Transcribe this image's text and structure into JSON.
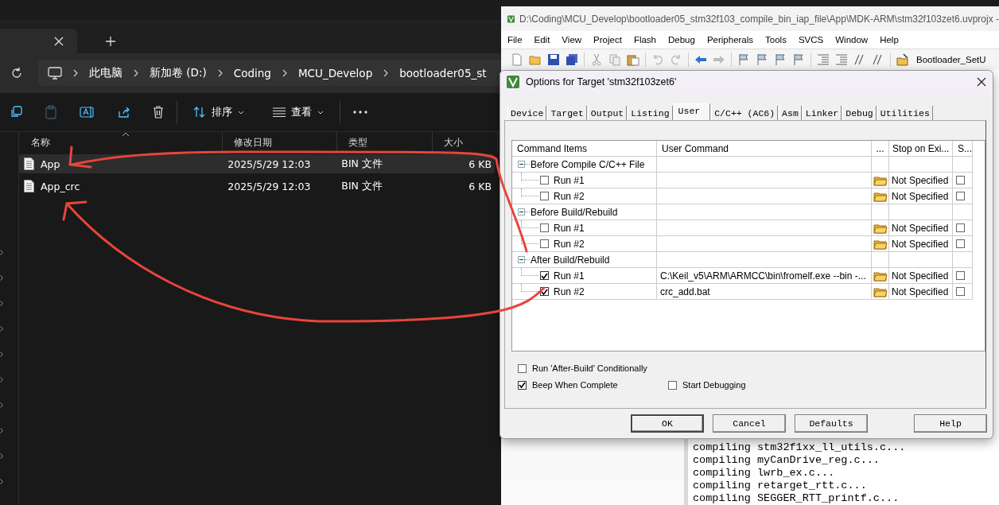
{
  "explorer": {
    "breadcrumb": [
      "此电脑",
      "新加卷 (D:)",
      "Coding",
      "MCU_Develop",
      "bootloader05_st"
    ],
    "toolbar": {
      "sort": "排序",
      "view": "查看"
    },
    "columns": [
      "名称",
      "修改日期",
      "类型",
      "大小"
    ],
    "files": [
      {
        "name": "App",
        "date": "2025/5/29 12:03",
        "type": "BIN 文件",
        "size": "6 KB",
        "selected": true
      },
      {
        "name": "App_crc",
        "date": "2025/5/29 12:03",
        "type": "BIN 文件",
        "size": "6 KB",
        "selected": false
      }
    ]
  },
  "keil": {
    "title": "D:\\Coding\\MCU_Develop\\bootloader05_stm32f103_compile_bin_iap_file\\App\\MDK-ARM\\stm32f103zet6.uvprojx -",
    "menu": [
      "File",
      "Edit",
      "View",
      "Project",
      "Flash",
      "Debug",
      "Peripherals",
      "Tools",
      "SVCS",
      "Window",
      "Help"
    ],
    "target": "Bootloader_SetU",
    "output": [
      "compiling stm32f1xx_ll_utils.c...",
      "compiling myCanDrive_reg.c...",
      "compiling lwrb_ex.c...",
      "compiling retarget_rtt.c...",
      "compiling SEGGER_RTT_printf.c..."
    ]
  },
  "dialog": {
    "title": "Options for Target 'stm32f103zet6'",
    "tabs": [
      {
        "label": "Device",
        "selected": false
      },
      {
        "label": "Target",
        "selected": false
      },
      {
        "label": "Output",
        "selected": false
      },
      {
        "label": "Listing",
        "selected": false
      },
      {
        "label": "User",
        "selected": true
      },
      {
        "label": "C/C++ (AC6)",
        "selected": false
      },
      {
        "label": "Asm",
        "selected": false
      },
      {
        "label": "Linker",
        "selected": false
      },
      {
        "label": "Debug",
        "selected": false
      },
      {
        "label": "Utilities",
        "selected": false
      }
    ],
    "columns": [
      "Command Items",
      "User Command",
      "...",
      "Stop on Exi...",
      "S..."
    ],
    "groups": [
      {
        "label": "Before Compile C/C++ File",
        "expanded": true,
        "children": [
          {
            "label": "Run #1",
            "checked": false,
            "stop": "Not Specified",
            "s_checked": false
          },
          {
            "label": "Run #2",
            "checked": false,
            "stop": "Not Specified",
            "s_checked": false
          }
        ]
      },
      {
        "label": "Before Build/Rebuild",
        "expanded": true,
        "children": [
          {
            "label": "Run #1",
            "checked": false,
            "stop": "Not Specified",
            "s_checked": false
          },
          {
            "label": "Run #2",
            "checked": false,
            "stop": "Not Specified",
            "s_checked": false
          }
        ]
      },
      {
        "label": "After Build/Rebuild",
        "expanded": true,
        "children": [
          {
            "label": "Run #1",
            "checked": true,
            "command": "C:\\Keil_v5\\ARM\\ARMCC\\bin\\fromelf.exe --bin -...",
            "stop": "Not Specified",
            "s_checked": false
          },
          {
            "label": "Run #2",
            "checked": true,
            "command": "crc_add.bat",
            "stop": "Not Specified",
            "s_checked": false
          }
        ]
      }
    ],
    "options": [
      {
        "label": "Run 'After-Build' Conditionally",
        "checked": false
      },
      {
        "label": "Beep When Complete",
        "checked": true
      },
      {
        "label": "Start Debugging",
        "checked": false
      }
    ],
    "buttons": [
      "OK",
      "Cancel",
      "Defaults",
      "Help"
    ]
  }
}
